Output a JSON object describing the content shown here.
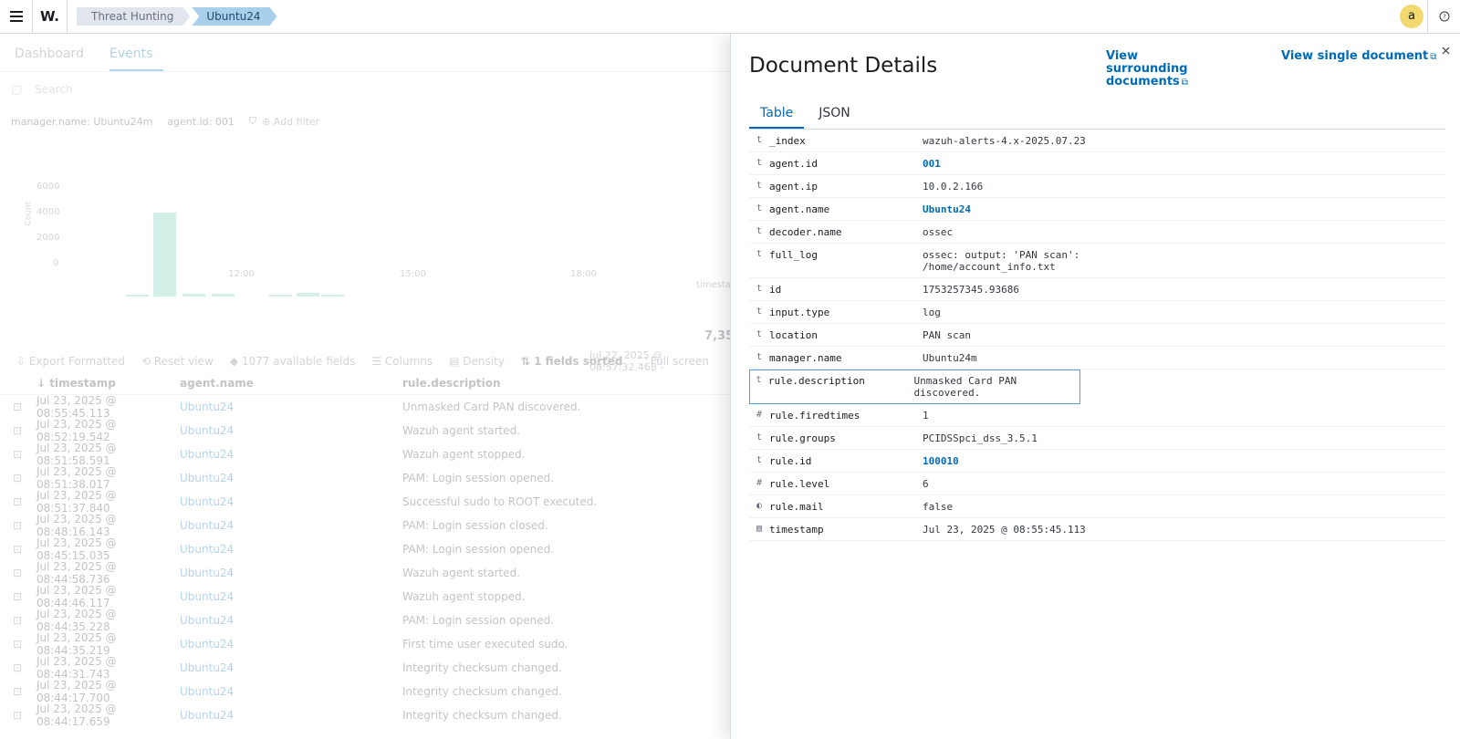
{
  "header": {
    "breadcrumbs": [
      "Threat Hunting",
      "Ubuntu24"
    ],
    "avatar_initial": "a"
  },
  "background": {
    "tabs": [
      "Dashboard",
      "Events"
    ],
    "search_placeholder": "Search",
    "filters": [
      "manager.name: Ubuntu24m",
      "agent.id: 001"
    ],
    "add_filter": "Add filter",
    "chart": {
      "count_label": "Count",
      "y_ticks": [
        "6000",
        "4000",
        "2000",
        "0"
      ],
      "x_ticks": [
        "12:00",
        "15:00",
        "18:00"
      ],
      "x_label": "timestamp"
    },
    "hits_partial": "7,35",
    "range_partial": "Jul 22, 2025 @ 08:57:32.468 -",
    "toolbar": {
      "export": "Export Formatted",
      "reset": "Reset view",
      "fields": "1077 available fields",
      "columns": "Columns",
      "density": "Density",
      "sorted": "1 fields sorted",
      "fullscreen": "Full screen"
    },
    "columns": [
      "timestamp",
      "agent.name",
      "rule.description"
    ],
    "rows": [
      {
        "ts": "Jul 23, 2025 @ 08:55:45.113",
        "agent": "Ubuntu24",
        "desc": "Unmasked Card PAN discovered."
      },
      {
        "ts": "Jul 23, 2025 @ 08:52:19.542",
        "agent": "Ubuntu24",
        "desc": "Wazuh agent started."
      },
      {
        "ts": "Jul 23, 2025 @ 08:51:58.591",
        "agent": "Ubuntu24",
        "desc": "Wazuh agent stopped."
      },
      {
        "ts": "Jul 23, 2025 @ 08:51:38.017",
        "agent": "Ubuntu24",
        "desc": "PAM: Login session opened."
      },
      {
        "ts": "Jul 23, 2025 @ 08:51:37.840",
        "agent": "Ubuntu24",
        "desc": "Successful sudo to ROOT executed."
      },
      {
        "ts": "Jul 23, 2025 @ 08:48:16.143",
        "agent": "Ubuntu24",
        "desc": "PAM: Login session closed."
      },
      {
        "ts": "Jul 23, 2025 @ 08:45:15.035",
        "agent": "Ubuntu24",
        "desc": "PAM: Login session opened."
      },
      {
        "ts": "Jul 23, 2025 @ 08:44:58.736",
        "agent": "Ubuntu24",
        "desc": "Wazuh agent started."
      },
      {
        "ts": "Jul 23, 2025 @ 08:44:46.117",
        "agent": "Ubuntu24",
        "desc": "Wazuh agent stopped."
      },
      {
        "ts": "Jul 23, 2025 @ 08:44:35.228",
        "agent": "Ubuntu24",
        "desc": "PAM: Login session opened."
      },
      {
        "ts": "Jul 23, 2025 @ 08:44:35.219",
        "agent": "Ubuntu24",
        "desc": "First time user executed sudo."
      },
      {
        "ts": "Jul 23, 2025 @ 08:44:31.743",
        "agent": "Ubuntu24",
        "desc": "Integrity checksum changed."
      },
      {
        "ts": "Jul 23, 2025 @ 08:44:17.700",
        "agent": "Ubuntu24",
        "desc": "Integrity checksum changed."
      },
      {
        "ts": "Jul 23, 2025 @ 08:44:17.659",
        "agent": "Ubuntu24",
        "desc": "Integrity checksum changed."
      }
    ]
  },
  "flyout": {
    "title": "Document Details",
    "link_surrounding": "View surrounding documents",
    "link_single": "View single document",
    "tabs": [
      "Table",
      "JSON"
    ],
    "fields": [
      {
        "type": "t",
        "name": "_index",
        "value": "wazuh-alerts-4.x-2025.07.23",
        "link": false
      },
      {
        "type": "t",
        "name": "agent.id",
        "value": "001",
        "link": true
      },
      {
        "type": "t",
        "name": "agent.ip",
        "value": "10.0.2.166",
        "link": false
      },
      {
        "type": "t",
        "name": "agent.name",
        "value": "Ubuntu24",
        "link": true
      },
      {
        "type": "t",
        "name": "decoder.name",
        "value": "ossec",
        "link": false
      },
      {
        "type": "t",
        "name": "full_log",
        "value": "ossec: output: 'PAN scan':\n/home/account_info.txt",
        "link": false
      },
      {
        "type": "t",
        "name": "id",
        "value": "1753257345.93686",
        "link": false
      },
      {
        "type": "t",
        "name": "input.type",
        "value": "log",
        "link": false
      },
      {
        "type": "t",
        "name": "location",
        "value": "PAN scan",
        "link": false
      },
      {
        "type": "t",
        "name": "manager.name",
        "value": "Ubuntu24m",
        "link": false
      },
      {
        "type": "t",
        "name": "rule.description",
        "value": "Unmasked Card PAN discovered.",
        "link": false,
        "selected": true
      },
      {
        "type": "#",
        "name": "rule.firedtimes",
        "value": "1",
        "link": false
      },
      {
        "type": "t",
        "name": "rule.groups",
        "value": "PCIDSSpci_dss_3.5.1",
        "link": false
      },
      {
        "type": "t",
        "name": "rule.id",
        "value": "100010",
        "link": true
      },
      {
        "type": "#",
        "name": "rule.level",
        "value": "6",
        "link": false
      },
      {
        "type": "bool",
        "name": "rule.mail",
        "value": "false",
        "link": false
      },
      {
        "type": "date",
        "name": "timestamp",
        "value": "Jul 23, 2025 @ 08:55:45.113",
        "link": false
      }
    ]
  }
}
